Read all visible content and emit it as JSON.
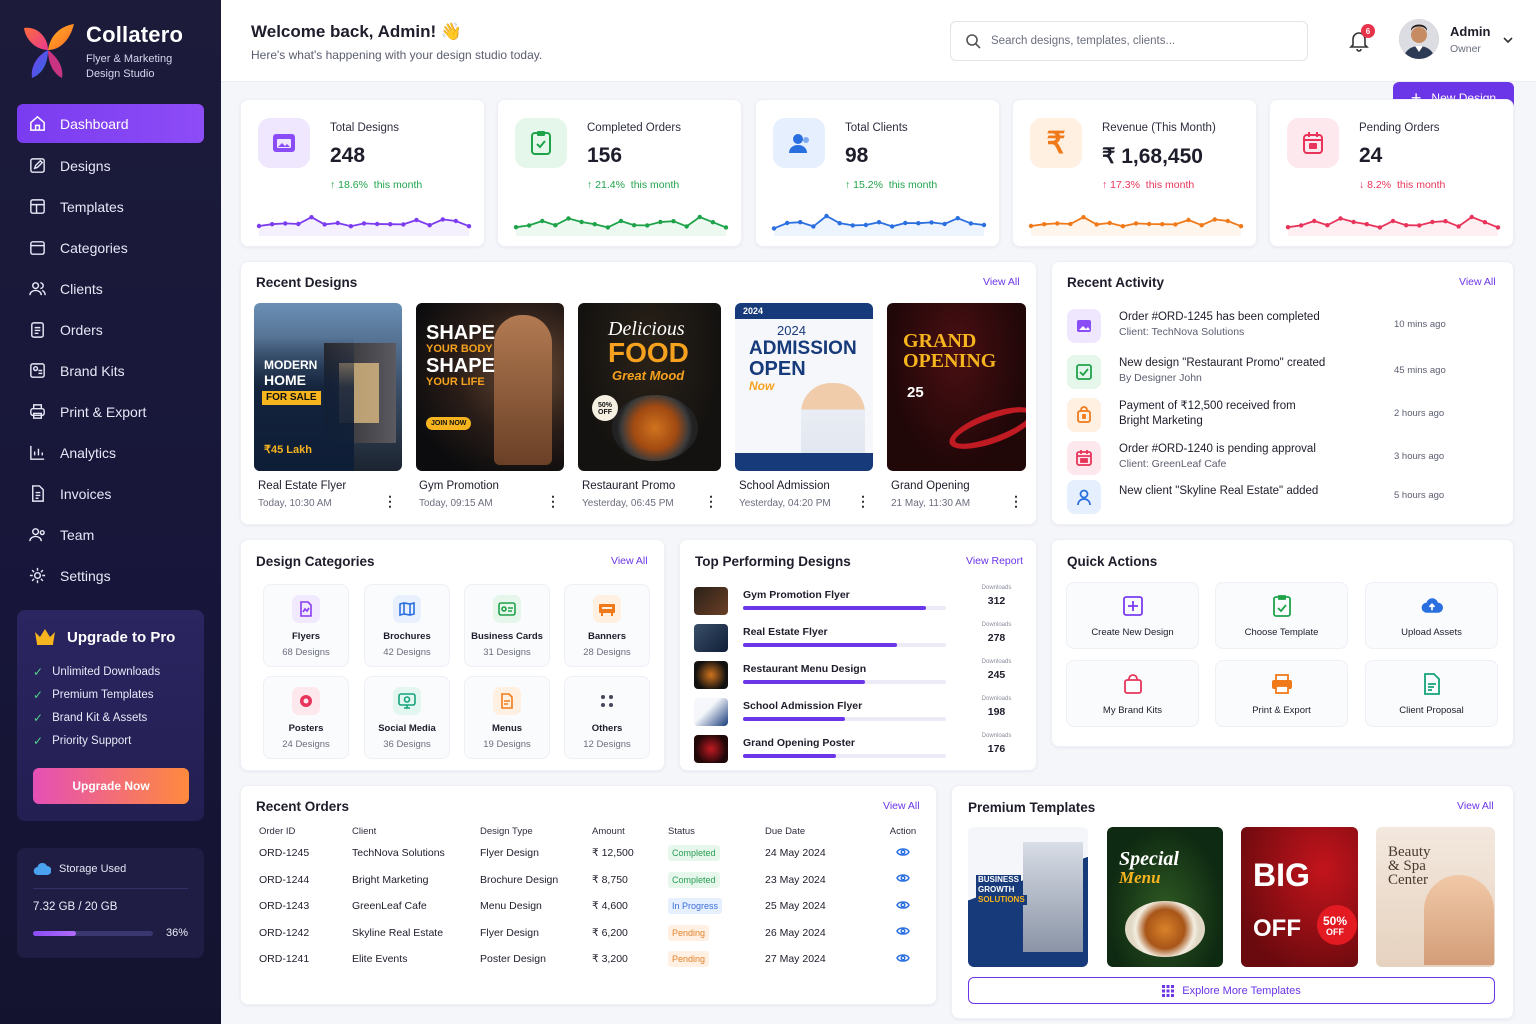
{
  "brand": {
    "name": "Collatero",
    "tagline_line1": "Flyer & Marketing",
    "tagline_line2": "Design Studio"
  },
  "nav": [
    {
      "label": "Dashboard",
      "icon": "home-icon",
      "active": true
    },
    {
      "label": "Designs",
      "icon": "edit-square-icon"
    },
    {
      "label": "Templates",
      "icon": "templates-icon"
    },
    {
      "label": "Categories",
      "icon": "folder-icon"
    },
    {
      "label": "Clients",
      "icon": "users-icon"
    },
    {
      "label": "Orders",
      "icon": "clipboard-icon"
    },
    {
      "label": "Brand Kits",
      "icon": "brand-kit-icon"
    },
    {
      "label": "Print & Export",
      "icon": "printer-icon"
    },
    {
      "label": "Analytics",
      "icon": "chart-icon"
    },
    {
      "label": "Invoices",
      "icon": "invoice-icon"
    },
    {
      "label": "Team",
      "icon": "team-icon"
    },
    {
      "label": "Settings",
      "icon": "gear-icon"
    }
  ],
  "upgrade": {
    "title": "Upgrade to Pro",
    "features": [
      "Unlimited Downloads",
      "Premium Templates",
      "Brand Kit & Assets",
      "Priority Support"
    ],
    "button": "Upgrade Now"
  },
  "storage": {
    "label": "Storage Used",
    "value": "7.32 GB / 20 GB",
    "percent_label": "36%",
    "percent": 0.36
  },
  "header": {
    "welcome": "Welcome back, Admin! 👋",
    "subtitle": "Here's what's happening with your design studio today.",
    "search_placeholder": "Search designs, templates, clients...",
    "notifications": "6",
    "user_name": "Admin",
    "user_role": "Owner",
    "new_design": "New Design"
  },
  "stats": [
    {
      "label": "Total Designs",
      "value": "248",
      "trend": "18.6%",
      "trend_suffix": "this month",
      "direction": "up",
      "color": "#7b3cf0"
    },
    {
      "label": "Completed Orders",
      "value": "156",
      "trend": "21.4%",
      "trend_suffix": "this month",
      "direction": "up",
      "color": "#1fa34a"
    },
    {
      "label": "Total Clients",
      "value": "98",
      "trend": "15.2%",
      "trend_suffix": "this month",
      "direction": "up",
      "color": "#2a6fe0"
    },
    {
      "label": "Revenue (This Month)",
      "value": "₹ 1,68,450",
      "trend": "17.3%",
      "trend_suffix": "this month",
      "direction": "up",
      "color": "#f07a1a"
    },
    {
      "label": "Pending Orders",
      "value": "24",
      "trend": "8.2%",
      "trend_suffix": "this month",
      "direction": "down",
      "color": "#e8345a"
    }
  ],
  "recent_designs": {
    "title": "Recent Designs",
    "view_all": "View All",
    "items": [
      {
        "name": "Real Estate Flyer",
        "time": "Today, 10:30 AM",
        "thumb_lines": [
          "MODERN",
          "HOME",
          "FOR SALE",
          "₹45 Lakh"
        ]
      },
      {
        "name": "Gym Promotion",
        "time": "Today, 09:15 AM",
        "thumb_lines": [
          "SHAPE",
          "YOUR BODY",
          "SHAPE",
          "YOUR LIFE",
          "JOIN NOW"
        ]
      },
      {
        "name": "Restaurant Promo",
        "time": "Yesterday, 06:45 PM",
        "thumb_lines": [
          "Delicious",
          "FOOD",
          "Great Mood",
          "50% OFF"
        ]
      },
      {
        "name": "School Admission",
        "time": "Yesterday, 04:20 PM",
        "thumb_lines": [
          "2024",
          "2024",
          "ADMISSION",
          "OPEN",
          "Now"
        ]
      },
      {
        "name": "Grand Opening",
        "time": "21 May, 11:30 AM",
        "thumb_lines": [
          "GRAND",
          "OPENING",
          "25"
        ]
      }
    ]
  },
  "recent_activity": {
    "title": "Recent Activity",
    "view_all": "View All",
    "items": [
      {
        "title": "Order #ORD-1245 has been completed",
        "sub": "Client: TechNova Solutions",
        "time": "10 mins ago",
        "icon": "image-icon"
      },
      {
        "title": "New design \"Restaurant Promo\" created",
        "sub": "By Designer John",
        "time": "45 mins ago",
        "icon": "check-square-icon"
      },
      {
        "title": "Payment of ₹12,500 received from",
        "sub": "Bright Marketing",
        "time": "2 hours ago",
        "icon": "shopping-bag-icon"
      },
      {
        "title": "Order #ORD-1240 is pending approval",
        "sub": "Client: GreenLeaf Cafe",
        "time": "3 hours ago",
        "icon": "calendar-icon"
      },
      {
        "title": "New client \"Skyline Real Estate\" added",
        "sub": "",
        "time": "5 hours ago",
        "icon": "user-icon"
      }
    ]
  },
  "categories": {
    "title": "Design Categories",
    "view_all": "View All",
    "items": [
      {
        "name": "Flyers",
        "count": "68 Designs",
        "icon": "flyer-icon",
        "color": "#8a3cf0",
        "bg": "#f1e9fe"
      },
      {
        "name": "Brochures",
        "count": "42 Designs",
        "icon": "brochure-icon",
        "color": "#2a6fe0",
        "bg": "#e8f0fd"
      },
      {
        "name": "Business Cards",
        "count": "31 Designs",
        "icon": "business-card-icon",
        "color": "#1fa34a",
        "bg": "#e6f6ea"
      },
      {
        "name": "Banners",
        "count": "28 Designs",
        "icon": "banner-icon",
        "color": "#f07a1a",
        "bg": "#fff0e2"
      },
      {
        "name": "Posters",
        "count": "24 Designs",
        "icon": "poster-icon",
        "color": "#e8345a",
        "bg": "#fde8ee"
      },
      {
        "name": "Social Media",
        "count": "36 Designs",
        "icon": "social-media-icon",
        "color": "#14a37a",
        "bg": "#e4f6f0"
      },
      {
        "name": "Menus",
        "count": "19 Designs",
        "icon": "menu-icon",
        "color": "#f07a1a",
        "bg": "#fff0e2"
      },
      {
        "name": "Others",
        "count": "12 Designs",
        "icon": "dots-grid-icon",
        "color": "#44475a",
        "bg": "#fafbfd"
      }
    ]
  },
  "top_designs": {
    "title": "Top Performing Designs",
    "view_all": "View Report",
    "downloads_label": "Downloads",
    "items": [
      {
        "name": "Gym Promotion Flyer",
        "downloads": "312",
        "ratio": 0.9
      },
      {
        "name": "Real Estate Flyer",
        "downloads": "278",
        "ratio": 0.76
      },
      {
        "name": "Restaurant Menu Design",
        "downloads": "245",
        "ratio": 0.6
      },
      {
        "name": "School Admission Flyer",
        "downloads": "198",
        "ratio": 0.5
      },
      {
        "name": "Grand Opening Poster",
        "downloads": "176",
        "ratio": 0.46
      }
    ]
  },
  "quick_actions": {
    "title": "Quick Actions",
    "items": [
      {
        "label": "Create New Design",
        "icon": "plus-square-icon",
        "color": "#7b3cf0"
      },
      {
        "label": "Choose Template",
        "icon": "template-doc-icon",
        "color": "#1fa34a"
      },
      {
        "label": "Upload Assets",
        "icon": "cloud-upload-icon",
        "color": "#2a6fe0"
      },
      {
        "label": "My Brand Kits",
        "icon": "bag-icon",
        "color": "#e8345a"
      },
      {
        "label": "Print & Export",
        "icon": "printer-icon",
        "color": "#f07a1a"
      },
      {
        "label": "Client Proposal",
        "icon": "proposal-icon",
        "color": "#14a37a"
      }
    ]
  },
  "orders": {
    "title": "Recent Orders",
    "view_all": "View All",
    "columns": [
      "Order ID",
      "Client",
      "Design Type",
      "Amount",
      "Status",
      "Due Date",
      "Action"
    ],
    "rows": [
      {
        "id": "ORD-1245",
        "client": "TechNova Solutions",
        "type": "Flyer Design",
        "amount": "₹ 12,500",
        "status": "Completed",
        "due": "24 May 2024"
      },
      {
        "id": "ORD-1244",
        "client": "Bright Marketing",
        "type": "Brochure Design",
        "amount": "₹ 8,750",
        "status": "Completed",
        "due": "23 May 2024"
      },
      {
        "id": "ORD-1243",
        "client": "GreenLeaf Cafe",
        "type": "Menu Design",
        "amount": "₹ 4,600",
        "status": "In Progress",
        "due": "25 May 2024"
      },
      {
        "id": "ORD-1242",
        "client": "Skyline Real Estate",
        "type": "Flyer Design",
        "amount": "₹ 6,200",
        "status": "Pending",
        "due": "26 May 2024"
      },
      {
        "id": "ORD-1241",
        "client": "Elite Events",
        "type": "Poster Design",
        "amount": "₹ 3,200",
        "status": "Pending",
        "due": "27 May 2024"
      }
    ]
  },
  "premium": {
    "title": "Premium Templates",
    "view_all": "View All",
    "explore": "Explore More Templates",
    "items": [
      {
        "lines": [
          "BUSINESS",
          "GROWTH",
          "SOLUTIONS"
        ]
      },
      {
        "lines": [
          "Special",
          "Menu"
        ]
      },
      {
        "lines": [
          "BIG",
          "OFF",
          "50%",
          "OFF"
        ]
      },
      {
        "lines": [
          "Beauty",
          "& Spa",
          "Center"
        ]
      }
    ]
  }
}
